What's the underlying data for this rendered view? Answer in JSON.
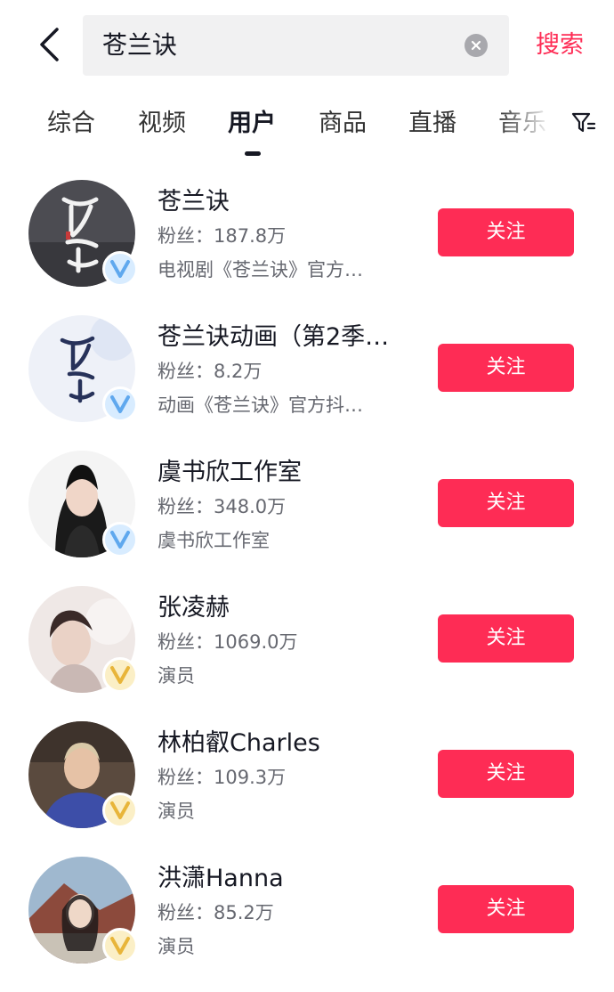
{
  "search": {
    "query": "苍兰诀",
    "submit_label": "搜索"
  },
  "tabs": [
    {
      "label": "综合"
    },
    {
      "label": "视频"
    },
    {
      "label": "用户",
      "active": true
    },
    {
      "label": "商品"
    },
    {
      "label": "直播"
    },
    {
      "label": "音乐"
    }
  ],
  "icons": {
    "back": "chevron-left-icon",
    "clear": "clear-x-icon",
    "filter": "filter-icon",
    "verified": "verified-v-icon"
  },
  "colors": {
    "accent": "#fe2c55",
    "verified_blue": "#5fa8ee",
    "verified_gold": "#e8b53a"
  },
  "users": [
    {
      "name": "苍兰诀",
      "fans": "粉丝：187.8万",
      "desc": "电视剧《苍兰诀》官方…",
      "badge": "blue",
      "follow_label": "关注"
    },
    {
      "name": "苍兰诀动画（第2季…",
      "fans": "粉丝：8.2万",
      "desc": "动画《苍兰诀》官方抖…",
      "badge": "blue",
      "follow_label": "关注"
    },
    {
      "name": "虞书欣工作室",
      "fans": "粉丝：348.0万",
      "desc": "虞书欣工作室",
      "badge": "blue",
      "follow_label": "关注"
    },
    {
      "name": "张凌赫",
      "fans": "粉丝：1069.0万",
      "desc": "演员",
      "badge": "gold",
      "follow_label": "关注"
    },
    {
      "name": "林柏叡Charles",
      "fans": "粉丝：109.3万",
      "desc": "演员",
      "badge": "gold",
      "follow_label": "关注"
    },
    {
      "name": "洪潇Hanna",
      "fans": "粉丝：85.2万",
      "desc": "演员",
      "badge": "gold",
      "follow_label": "关注"
    }
  ]
}
